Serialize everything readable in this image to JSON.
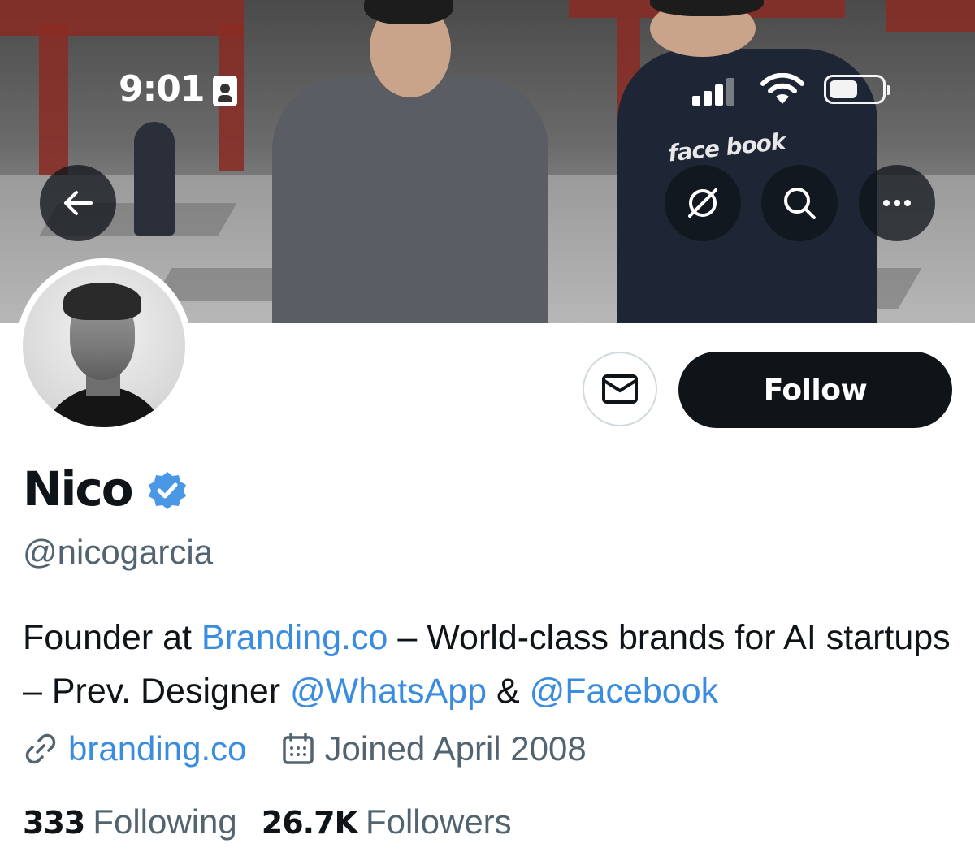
{
  "status_bar": {
    "time": "9:01"
  },
  "profile": {
    "name": "Nico",
    "handle": "@nicogarcia",
    "bio": {
      "part1": "Founder at ",
      "link1": "Branding.co",
      "part2": " – World-class brands for AI startups – Prev. Designer ",
      "mention1": "@WhatsApp",
      "part3": " & ",
      "mention2": "@Facebook"
    },
    "website": "branding.co",
    "joined": "Joined April 2008",
    "following_count": "333",
    "following_label": "Following",
    "followers_count": "26.7K",
    "followers_label": "Followers"
  },
  "actions": {
    "follow_label": "Follow"
  },
  "banner": {
    "hoodie_text": "face book"
  },
  "colors": {
    "link": "#3a8ce0",
    "verified": "#4a97e6",
    "follow_bg": "#0f1419",
    "secondary_text": "#536471"
  },
  "icons": {
    "back": "arrow-left-icon",
    "disconnect": "disconnect-icon",
    "search": "search-icon",
    "more": "more-icon",
    "message": "mail-icon",
    "verified": "verified-badge-icon",
    "link": "link-icon",
    "calendar": "calendar-icon"
  }
}
